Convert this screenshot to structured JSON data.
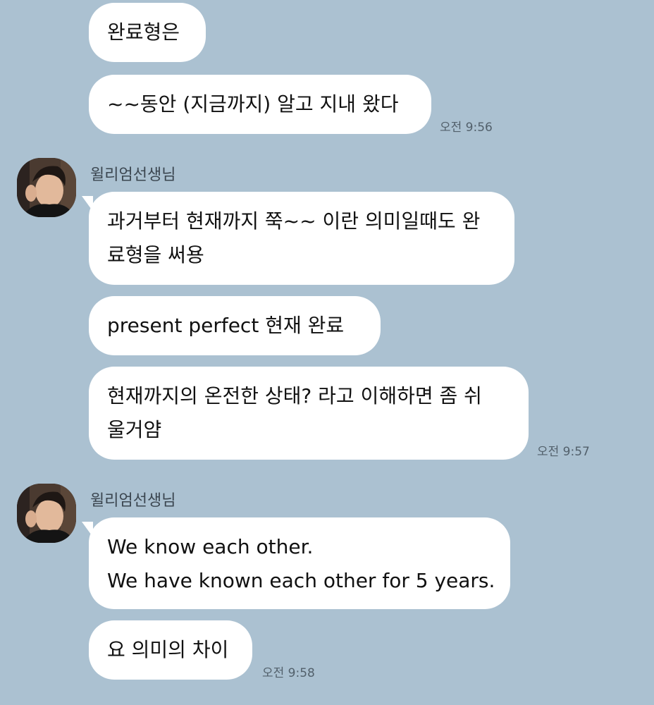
{
  "messages": [
    {
      "text": "완료형은"
    },
    {
      "text": "~~동안 (지금까지) 알고 지내 왔다",
      "time": "오전 9:56"
    },
    {
      "sender": "윌리엄선생님",
      "lines": [
        "과거부터 현재까지 쭉~~ 이란 의미일때도 완",
        "료형을 써용"
      ]
    },
    {
      "text": "present perfect  현재 완료"
    },
    {
      "lines": [
        "현재까지의 온전한 상태? 라고 이해하면 좀 쉬",
        "울거얌"
      ],
      "time": "오전 9:57"
    },
    {
      "sender": "윌리엄선생님",
      "lines": [
        "We know each other.",
        "We have known each other for 5 years."
      ]
    },
    {
      "text": "요 의미의 차이",
      "time": "오전 9:58"
    }
  ],
  "icons": {
    "avatar": "profile-photo"
  },
  "colors": {
    "background": "#abc1d1",
    "bubble": "#ffffff"
  }
}
